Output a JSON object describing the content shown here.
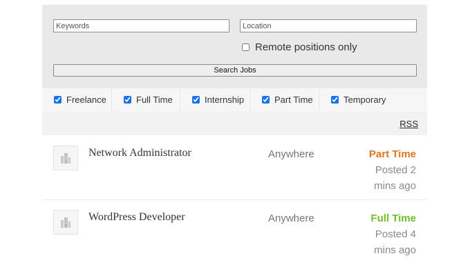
{
  "search": {
    "keywords_placeholder": "Keywords",
    "keywords_value": "",
    "location_placeholder": "Location",
    "location_value": "",
    "remote_label": "Remote positions only",
    "remote_checked": false,
    "submit_label": "Search Jobs"
  },
  "job_types": [
    {
      "label": "Freelance",
      "checked": true
    },
    {
      "label": "Full Time",
      "checked": true
    },
    {
      "label": "Internship",
      "checked": true
    },
    {
      "label": "Part Time",
      "checked": true
    },
    {
      "label": "Temporary",
      "checked": true
    }
  ],
  "rss_label": "RSS",
  "jobs": [
    {
      "title": "Network Administrator",
      "location": "Anywhere",
      "type": "Part Time",
      "type_color": "#e27522",
      "posted_line1": "Posted 2",
      "posted_line2": "mins ago",
      "logo_icon": "building-icon"
    },
    {
      "title": "WordPress Developer",
      "location": "Anywhere",
      "type": "Full Time",
      "type_color": "#6fc02b",
      "posted_line1": "Posted 4",
      "posted_line2": "mins ago",
      "logo_icon": "building-icon"
    }
  ]
}
